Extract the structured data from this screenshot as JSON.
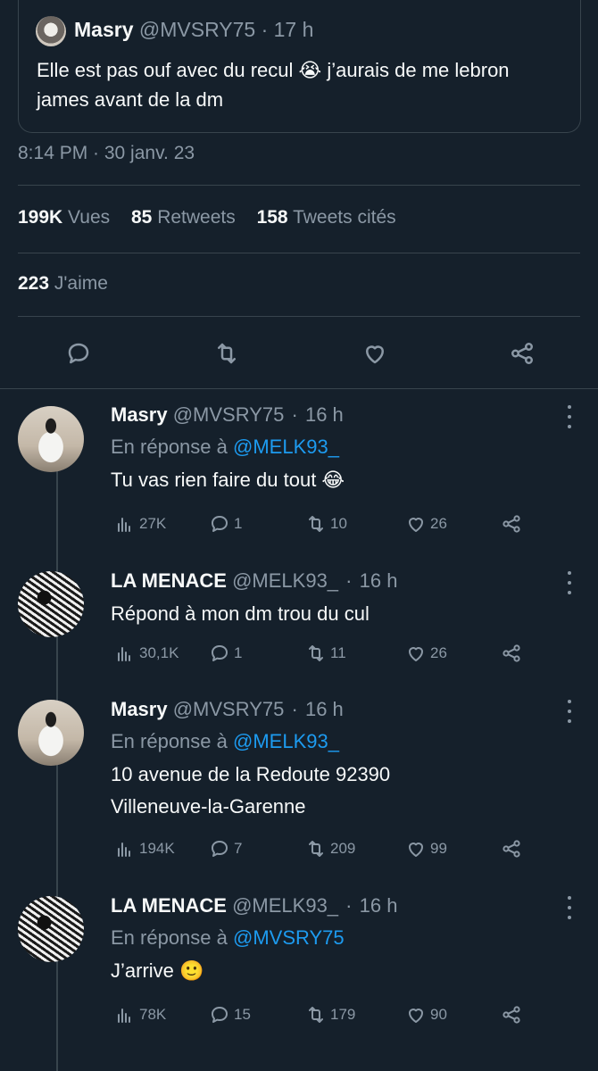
{
  "quoted": {
    "name": "Masry",
    "handle": "@MVSRY75",
    "time": "17 h",
    "text": "Elle est pas ouf avec du recul 😭 j’aurais de me lebron james avant de la dm"
  },
  "timestamp": "8:14 PM · 30 janv. 23",
  "stats": {
    "views_count": "199K",
    "views_label": "Vues",
    "retweets_count": "85",
    "retweets_label": "Retweets",
    "quotes_count": "158",
    "quotes_label": "Tweets cités",
    "likes_count": "223",
    "likes_label": "J'aime"
  },
  "actions": [
    "reply-icon",
    "retweet-icon",
    "like-icon",
    "share-icon"
  ],
  "replies": [
    {
      "name": "Masry",
      "handle": "@MVSRY75",
      "time": "16 h",
      "reply_prefix": "En réponse à",
      "reply_to": "@MELK93_",
      "text": "Tu vas rien faire du tout 😂",
      "views": "27K",
      "replies": "1",
      "retweets": "10",
      "likes": "26"
    },
    {
      "name": "LA MENACE",
      "handle": "@MELK93_",
      "time": "16 h",
      "text": "Répond à mon dm trou du cul",
      "views": "30,1K",
      "replies": "1",
      "retweets": "11",
      "likes": "26"
    },
    {
      "name": "Masry",
      "handle": "@MVSRY75",
      "time": "16 h",
      "reply_prefix": "En réponse à",
      "reply_to": "@MELK93_",
      "text": "10 avenue de la Redoute 92390 Villeneuve-la-Garenne",
      "views": "194K",
      "replies": "7",
      "retweets": "209",
      "likes": "99"
    },
    {
      "name": "LA MENACE",
      "handle": "@MELK93_",
      "time": "16 h",
      "reply_prefix": "En réponse à",
      "reply_to": "@MVSRY75",
      "text": "J’arrive 🙂",
      "views": "78K",
      "replies": "15",
      "retweets": "179",
      "likes": "90"
    }
  ],
  "colors": {
    "background": "#15202b",
    "text": "#f7f9f9",
    "muted": "#8b98a5",
    "link": "#1d9bf0",
    "border": "#38444d"
  }
}
